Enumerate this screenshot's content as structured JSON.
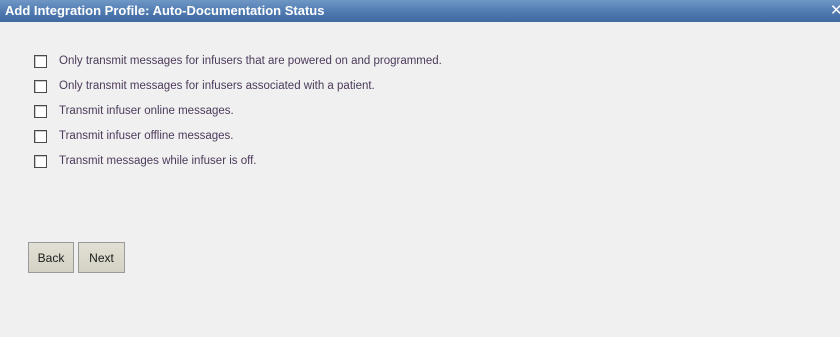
{
  "dialog": {
    "title": "Add Integration Profile: Auto-Documentation Status",
    "close_glyph": "✕"
  },
  "options": [
    {
      "label": "Only transmit messages for infusers that are powered on and programmed.",
      "checked": false
    },
    {
      "label": "Only transmit messages for infusers associated with a patient.",
      "checked": false
    },
    {
      "label": "Transmit infuser online messages.",
      "checked": false
    },
    {
      "label": "Transmit infuser offline messages.",
      "checked": false
    },
    {
      "label": "Transmit messages while infuser is off.",
      "checked": false
    }
  ],
  "buttons": {
    "back_label": "Back",
    "next_label": "Next"
  },
  "colors": {
    "titlebar": "#4f7ab0",
    "dialog_bg": "#f0f0f0",
    "label_text": "#4b3a5a"
  }
}
